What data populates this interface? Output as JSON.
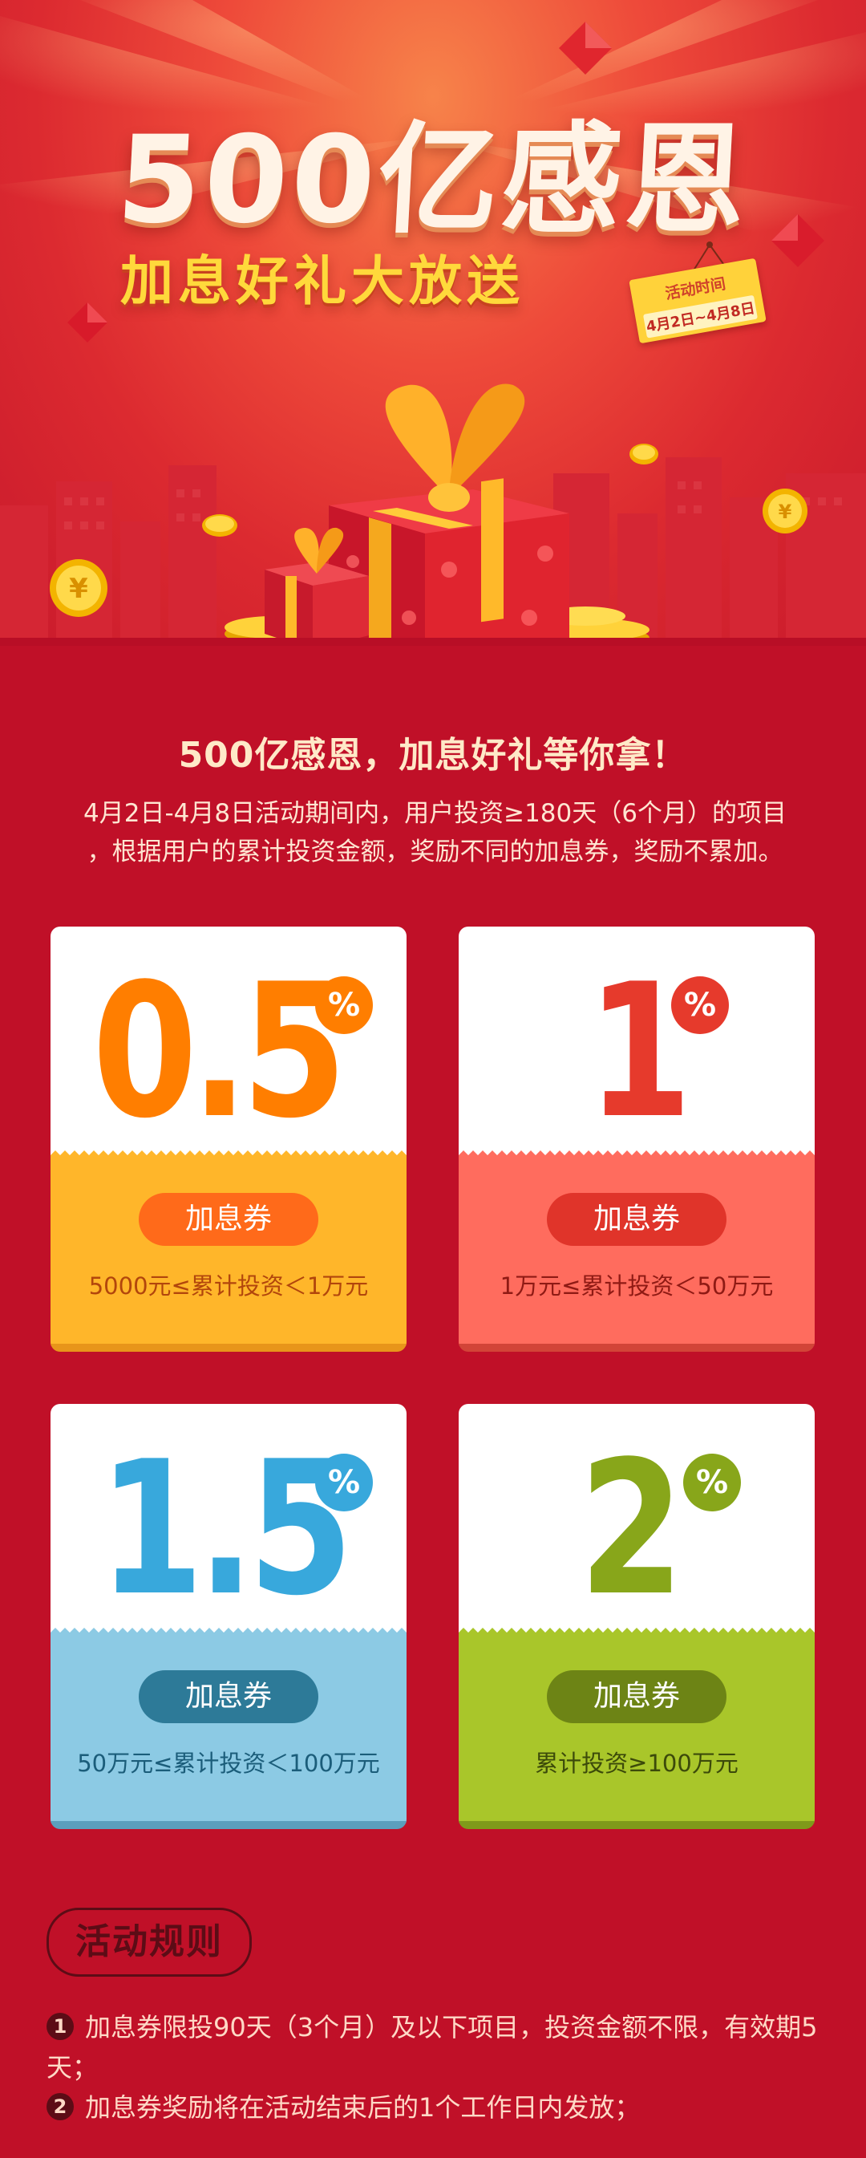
{
  "hero": {
    "title": "500亿感恩",
    "subtitle": "加息好礼大放送",
    "tag_label": "活动时间",
    "tag_dates": "4月2日~4月8日"
  },
  "intro": {
    "title": "500亿感恩，加息好礼等你拿！",
    "line1": "4月2日-4月8日活动期间内，用户投资≥180天（6个月）的项目",
    "line2": "，根据用户的累计投资金额，奖励不同的加息券，奖励不累加。"
  },
  "cards": [
    {
      "rate": "0.5",
      "percent": "%",
      "label": "加息券",
      "condition": "5000元≤累计投资＜1万元",
      "colors": {
        "number": "#ff7e00",
        "bottom": "#ffb62a",
        "pill": "#ff6a1a",
        "text": "#b2460c",
        "edge": "#e8951a"
      }
    },
    {
      "rate": "1",
      "percent": "%",
      "label": "加息券",
      "condition": "1万元≤累计投资＜50万元",
      "colors": {
        "number": "#e63a2c",
        "bottom": "#ff6c5e",
        "pill": "#e0342a",
        "text": "#8f1a14",
        "edge": "#d24438"
      }
    },
    {
      "rate": "1.5",
      "percent": "%",
      "label": "加息券",
      "condition": "50万元≤累计投资＜100万元",
      "colors": {
        "number": "#38a8dc",
        "bottom": "#8ccae4",
        "pill": "#2d7a98",
        "text": "#1b5d7a",
        "edge": "#5b9fbd"
      }
    },
    {
      "rate": "2",
      "percent": "%",
      "label": "加息券",
      "condition": "累计投资≥100万元",
      "colors": {
        "number": "#88a61a",
        "bottom": "#a9c62a",
        "pill": "#6d8415",
        "text": "#3c4a0a",
        "edge": "#7f9a1a"
      }
    }
  ],
  "rules": {
    "title": "活动规则",
    "items": [
      {
        "num": "1",
        "text": "加息券限投90天（3个月）及以下项目，投资金额不限，有效期5天；"
      },
      {
        "num": "2",
        "text": "加息券奖励将在活动结束后的1个工作日内发放；"
      }
    ]
  }
}
